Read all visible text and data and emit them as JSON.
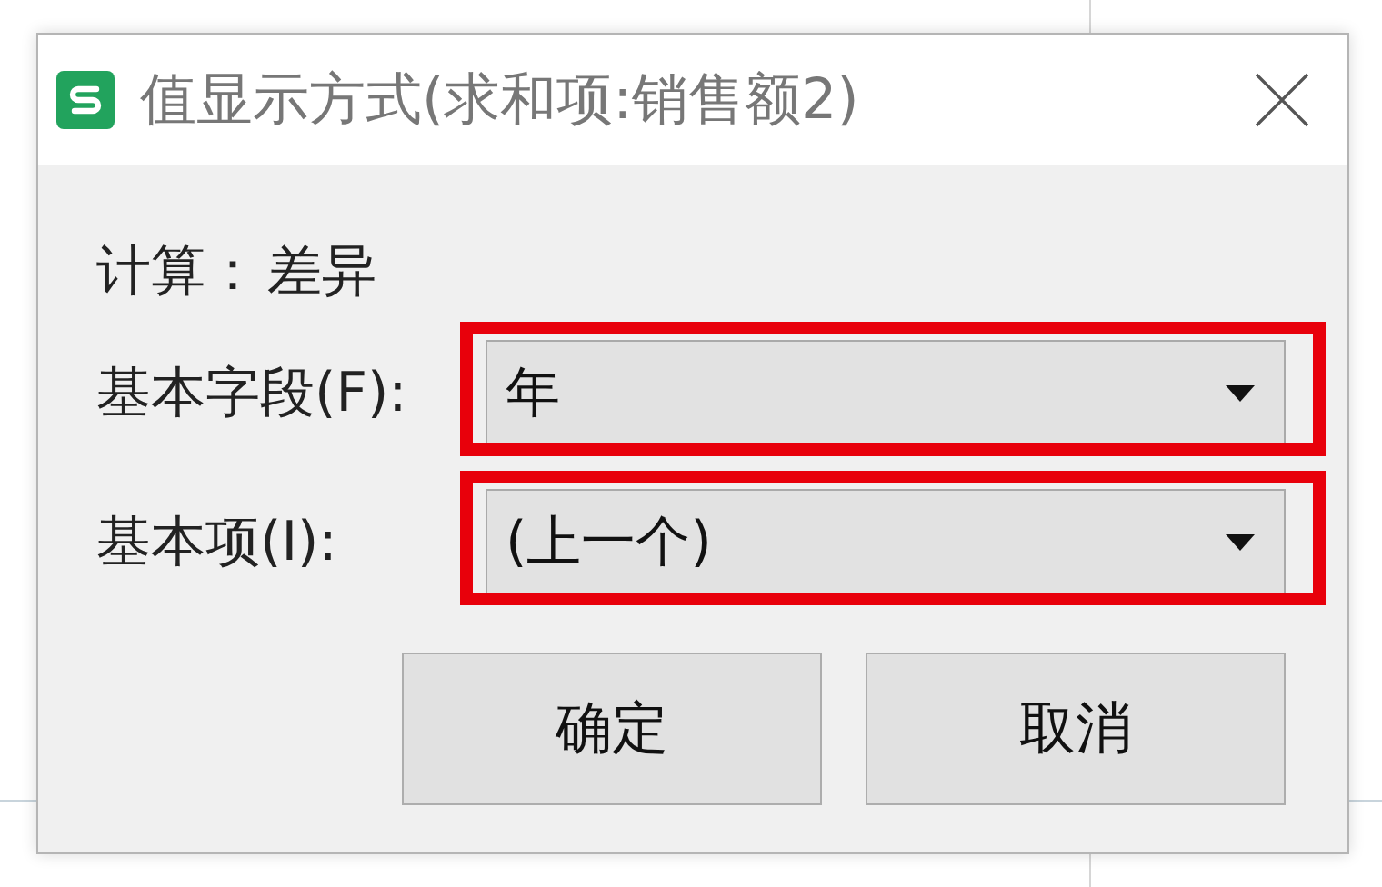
{
  "window": {
    "title": "值显示方式(求和项:销售额2)"
  },
  "calculation": {
    "label": "计算：",
    "value": "差异"
  },
  "fields": [
    {
      "label": "基本字段(F):",
      "value": "年",
      "highlighted": true
    },
    {
      "label": "基本项(I):",
      "value": "(上一个)",
      "highlighted": true
    }
  ],
  "buttons": [
    "确定",
    "取消"
  ]
}
